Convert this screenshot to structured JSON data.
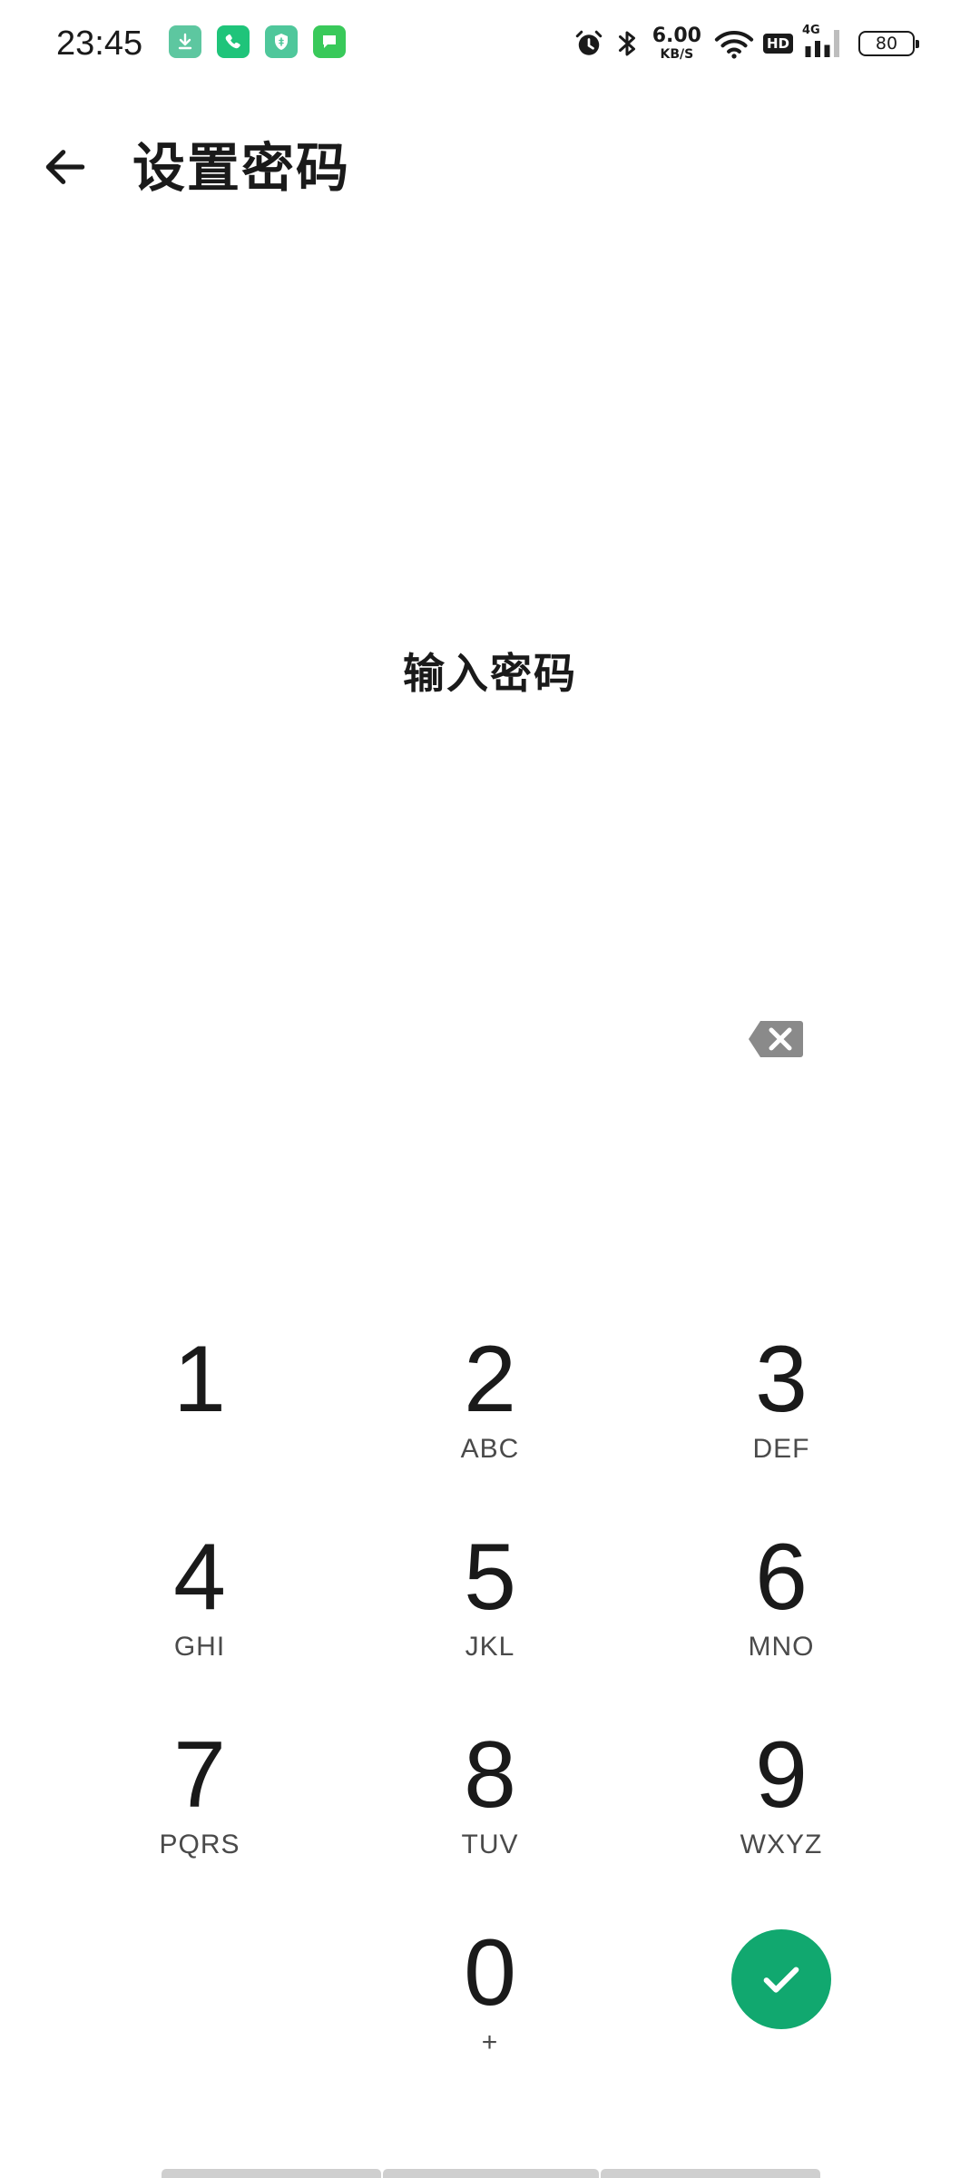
{
  "status_bar": {
    "time": "23:45",
    "notifications": [
      {
        "name": "download-icon",
        "color": "#5dc7a0"
      },
      {
        "name": "phone-icon",
        "color": "#1fc47a"
      },
      {
        "name": "shield-icon",
        "color": "#4fc79b"
      },
      {
        "name": "message-icon",
        "color": "#39c95a"
      }
    ],
    "net_speed_value": "6.00",
    "net_speed_unit": "KB/S",
    "hd_label": "HD",
    "network_type": "4G",
    "battery_level": "80"
  },
  "app_bar": {
    "back_icon": "arrow-left-icon",
    "title": "设置密码"
  },
  "prompt": "输入密码",
  "delete_icon": "backspace-icon",
  "keypad": {
    "keys": [
      {
        "digit": "1",
        "letters": ""
      },
      {
        "digit": "2",
        "letters": "ABC"
      },
      {
        "digit": "3",
        "letters": "DEF"
      },
      {
        "digit": "4",
        "letters": "GHI"
      },
      {
        "digit": "5",
        "letters": "JKL"
      },
      {
        "digit": "6",
        "letters": "MNO"
      },
      {
        "digit": "7",
        "letters": "PQRS"
      },
      {
        "digit": "8",
        "letters": "TUV"
      },
      {
        "digit": "9",
        "letters": "WXYZ"
      },
      {
        "digit": "0",
        "letters": "+"
      }
    ],
    "confirm_icon": "checkmark-icon"
  },
  "colors": {
    "accent": "#11a86f",
    "text": "#1a1a1a",
    "secondary_text": "#4a4a4a",
    "icon_gray": "#8a8a8a"
  }
}
